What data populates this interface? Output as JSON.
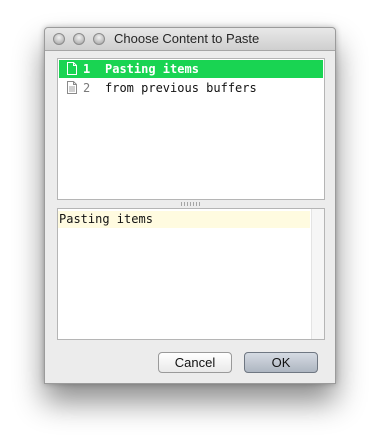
{
  "window": {
    "title": "Choose Content to Paste"
  },
  "list": {
    "items": [
      {
        "index": "1",
        "text": "Pasting items",
        "selected": true
      },
      {
        "index": "2",
        "text": "from previous buffers",
        "selected": false
      }
    ]
  },
  "preview": {
    "text": "Pasting items"
  },
  "buttons": {
    "cancel_label": "Cancel",
    "ok_label": "OK"
  },
  "colors": {
    "selection": "#19d452",
    "preview_highlight": "#fffbe0"
  },
  "icons": {
    "window_controls": [
      "close-icon",
      "minimize-icon",
      "zoom-icon"
    ],
    "item_icon": "document-icon"
  }
}
